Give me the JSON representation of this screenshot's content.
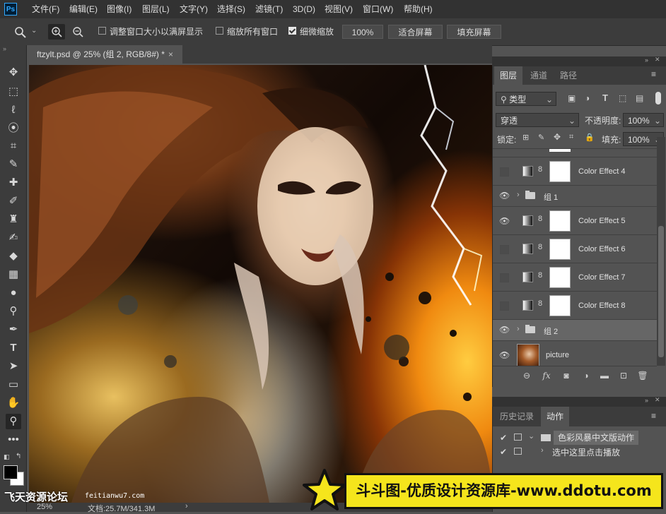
{
  "menubar": {
    "logo": "Ps",
    "items": [
      "文件(F)",
      "编辑(E)",
      "图像(I)",
      "图层(L)",
      "文字(Y)",
      "选择(S)",
      "滤镜(T)",
      "3D(D)",
      "视图(V)",
      "窗口(W)",
      "帮助(H)"
    ]
  },
  "options": {
    "resize_windows": "调整窗口大小以满屏显示",
    "zoom_all": "缩放所有窗口",
    "scrubby_zoom": "细微缩放",
    "zoom_value": "100%",
    "fit_screen": "适合屏幕",
    "fill_screen": "填充屏幕"
  },
  "document": {
    "tab_title": "ftzylt.psd @ 25% (组 2, RGB/8#) *",
    "close": "×"
  },
  "layers_panel": {
    "tabs": [
      "图层",
      "通道",
      "路径"
    ],
    "filter_kind": "类型",
    "blend_mode": "穿透",
    "opacity_label": "不透明度:",
    "opacity_value": "100%",
    "lock_label": "锁定:",
    "fill_label": "填充:",
    "fill_value": "100%",
    "layers": [
      {
        "name": "Color Effect 4",
        "visible": false
      },
      {
        "name": "组 1",
        "visible": true
      },
      {
        "name": "Color Effect 5",
        "visible": true
      },
      {
        "name": "Color Effect 6",
        "visible": false
      },
      {
        "name": "Color Effect 7",
        "visible": false
      },
      {
        "name": "Color Effect 8",
        "visible": false
      },
      {
        "name": "组 2",
        "visible": true
      },
      {
        "name": "picture",
        "visible": true
      }
    ]
  },
  "history_panel": {
    "tabs": [
      "历史记录",
      "动作"
    ],
    "items": [
      "色彩风暴中文版动作",
      "选中这里点击播放"
    ]
  },
  "status": {
    "zoom": "25%",
    "doc_size": "文档:25.7M/341.3M"
  },
  "watermarks": {
    "left_text": "飞天资源论坛",
    "left_url": "feitianwu7.com",
    "right_text": "斗斗图-优质设计资源库-www.ddotu.com"
  },
  "icons": {
    "eye": "👁",
    "link": "8",
    "check": "✔"
  }
}
